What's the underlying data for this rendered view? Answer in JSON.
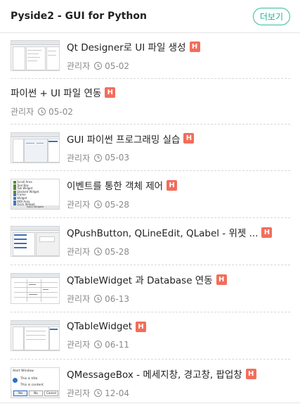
{
  "header": {
    "title": "Pyside2 - GUI for Python",
    "more_label": "더보기"
  },
  "posts": [
    {
      "title": "Qt Designer로 UI 파일 생성",
      "badge": "H",
      "author": "관리자",
      "date": "05-02",
      "thumb": "designer-screenshot"
    },
    {
      "title": "파이썬 + UI 파일 연동",
      "badge": "H",
      "author": "관리자",
      "date": "05-02",
      "thumb": ""
    },
    {
      "title": "GUI 파이썬 프로그래밍 실습",
      "badge": "H",
      "author": "관리자",
      "date": "05-03",
      "thumb": "designer-screenshot"
    },
    {
      "title": "이벤트를 통한 객체 제어",
      "badge": "H",
      "author": "관리자",
      "date": "05-28",
      "thumb": "widget-box-screenshot"
    },
    {
      "title": "QPushButton, QLineEdit, QLabel - 위젯 ...",
      "badge": "H",
      "author": "관리자",
      "date": "05-28",
      "thumb": "designer-screenshot"
    },
    {
      "title": "QTableWidget 과 Database 연동",
      "badge": "H",
      "author": "관리자",
      "date": "06-13",
      "thumb": "table-screenshot"
    },
    {
      "title": "QTableWidget",
      "badge": "H",
      "author": "관리자",
      "date": "06-11",
      "thumb": "designer-screenshot"
    },
    {
      "title": "QMessageBox - 메세지창, 경고창, 팝업창",
      "badge": "H",
      "author": "관리자",
      "date": "12-04",
      "thumb": "messagebox-screenshot"
    }
  ],
  "thumb_texts": {
    "messagebox": {
      "title": "Alert Window",
      "line1": "This is title",
      "line2": "This is content",
      "btn1": "Yes",
      "btn2": "No",
      "btn3": "Cancel"
    },
    "widgetbox": {
      "items": [
        "Scroll Area",
        "Tool Box",
        "Tab Widget",
        "Stacked Widget",
        "Frame",
        "Widget",
        "MDI Area",
        "Dock Widget"
      ],
      "footer": "Input Widgets"
    }
  },
  "colors": {
    "accent": "#2fbf9a",
    "badge": "#f26d5b",
    "meta": "#8a8a8a"
  }
}
